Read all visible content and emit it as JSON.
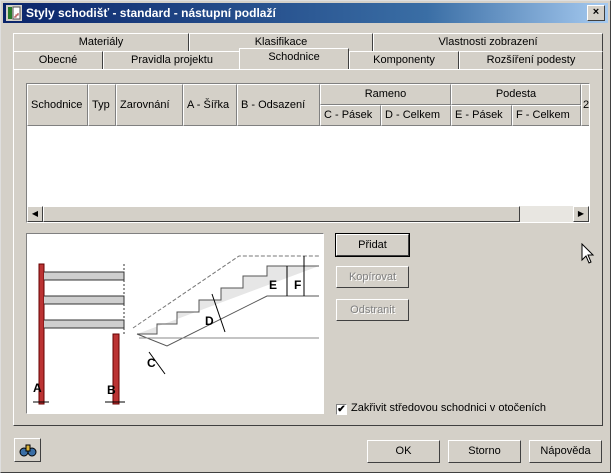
{
  "window": {
    "title": "Styly schodišť - standard - nástupní podlaží",
    "close_label": "×"
  },
  "tabs_back": [
    "Materiály",
    "Klasifikace",
    "Vlastnosti zobrazení"
  ],
  "tabs_front": [
    "Obecné",
    "Pravidla projektu",
    "Schodnice",
    "Komponenty",
    "Rozšíření podesty"
  ],
  "active_tab": "Schodnice",
  "table": {
    "group_headers": [
      "Rameno",
      "Podesta"
    ],
    "columns": [
      "Schodnice",
      "Typ",
      "Zarovnání",
      "A - Šířka",
      "B - Odsazení",
      "C - Pásek",
      "D - Celkem",
      "E - Pásek",
      "F - Celkem",
      "2"
    ],
    "rows": []
  },
  "illustration": {
    "labels": [
      "A",
      "B",
      "C",
      "D",
      "E",
      "F"
    ]
  },
  "buttons": {
    "add": "Přidat",
    "copy": "Kopírovat",
    "remove": "Odstranit",
    "ok": "OK",
    "cancel": "Storno",
    "help": "Nápověda"
  },
  "checkbox": {
    "label": "Zakřivit středovou schodnici v otočeních",
    "checked": true,
    "mark": "✔"
  },
  "scrollbar": {
    "left_arrow": "◀",
    "right_arrow": "▶"
  }
}
